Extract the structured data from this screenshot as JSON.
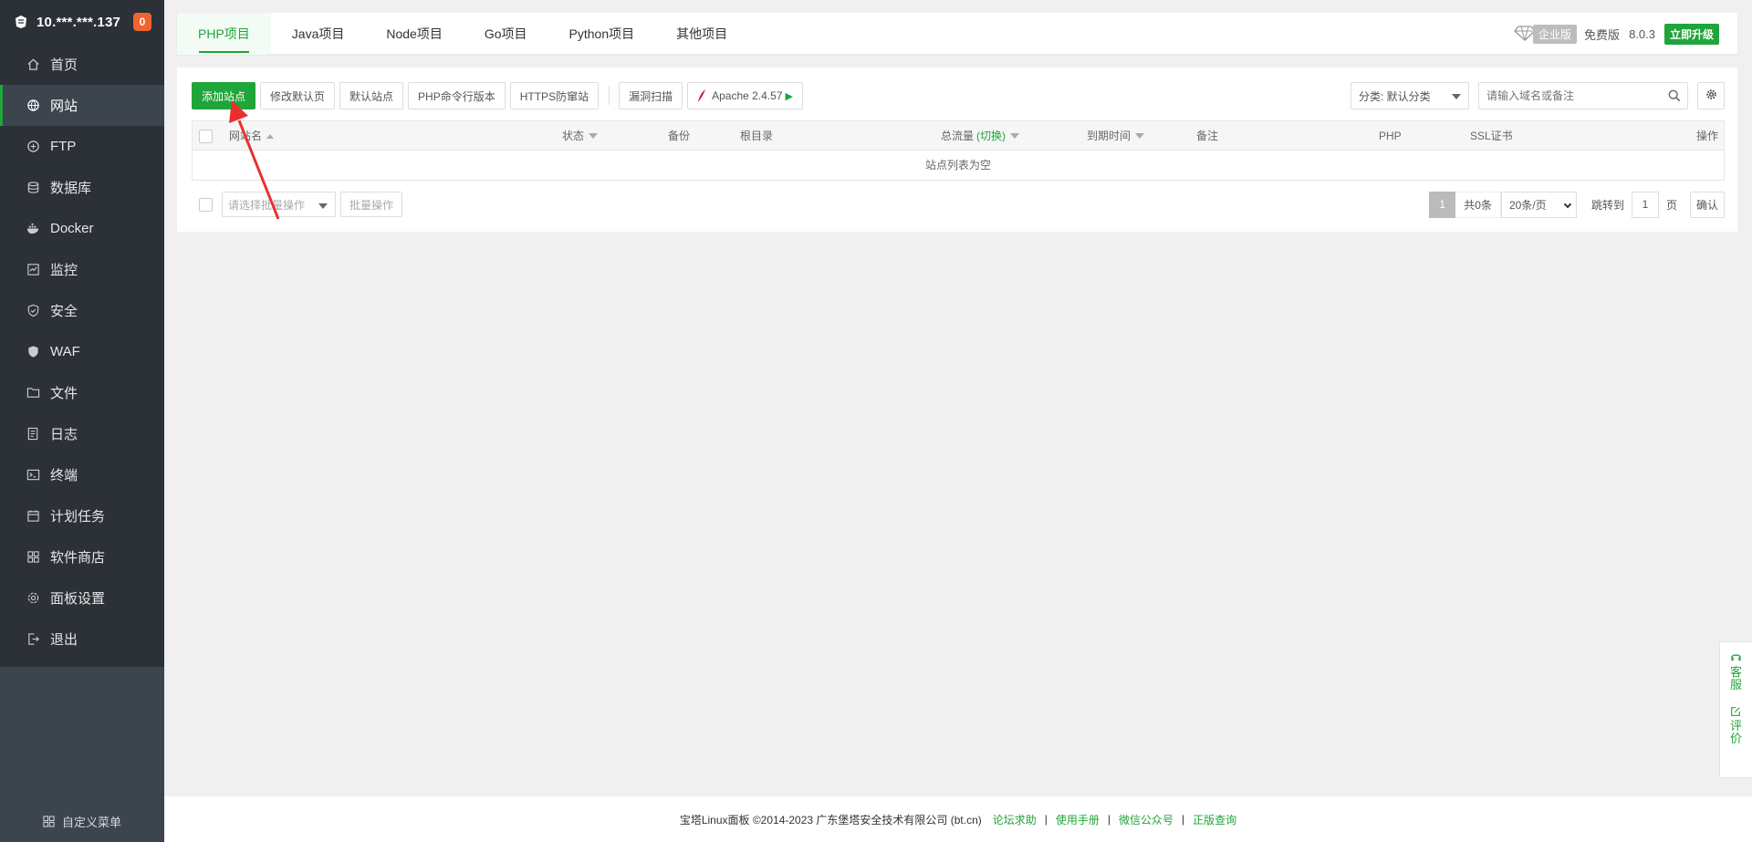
{
  "sidebar": {
    "server_ip": "10.***.***.137",
    "badge_count": "0",
    "items": [
      {
        "label": "首页",
        "icon": "home-icon"
      },
      {
        "label": "网站",
        "icon": "globe-icon",
        "active": true
      },
      {
        "label": "FTP",
        "icon": "ftp-icon"
      },
      {
        "label": "数据库",
        "icon": "database-icon"
      },
      {
        "label": "Docker",
        "icon": "docker-icon"
      },
      {
        "label": "监控",
        "icon": "monitor-icon"
      },
      {
        "label": "安全",
        "icon": "shield-icon"
      },
      {
        "label": "WAF",
        "icon": "waf-shield-icon"
      },
      {
        "label": "文件",
        "icon": "folder-icon"
      },
      {
        "label": "日志",
        "icon": "log-icon"
      },
      {
        "label": "终端",
        "icon": "terminal-icon"
      },
      {
        "label": "计划任务",
        "icon": "calendar-icon"
      },
      {
        "label": "软件商店",
        "icon": "apps-icon"
      },
      {
        "label": "面板设置",
        "icon": "gear-icon"
      },
      {
        "label": "退出",
        "icon": "logout-icon"
      }
    ],
    "custom_menu": "自定义菜单"
  },
  "header": {
    "tabs": [
      "PHP项目",
      "Java项目",
      "Node项目",
      "Go项目",
      "Python项目",
      "其他项目"
    ],
    "active_tab": 0,
    "enterprise_label": "企业版",
    "free_label": "免费版",
    "version": "8.0.3",
    "upgrade_label": "立即升级"
  },
  "toolbar": {
    "add_site": "添加站点",
    "edit_default_page": "修改默认页",
    "default_site": "默认站点",
    "php_cli_version": "PHP命令行版本",
    "https_protection": "HTTPS防窜站",
    "vuln_scan": "漏洞扫描",
    "apache": "Apache 2.4.57",
    "category_select": "分类: 默认分类",
    "search_placeholder": "请输入域名或备注"
  },
  "table": {
    "headers": {
      "site_name": "网站名",
      "status": "状态",
      "backup": "备份",
      "root_dir": "根目录",
      "traffic": "总流量",
      "traffic_switch": "(切换)",
      "expire": "到期时间",
      "remark": "备注",
      "php": "PHP",
      "ssl": "SSL证书",
      "actions": "操作"
    },
    "empty_text": "站点列表为空"
  },
  "batch": {
    "select_placeholder": "请选择批量操作",
    "batch_button": "批量操作"
  },
  "pagination": {
    "current": "1",
    "total": "共0条",
    "page_size": "20条/页",
    "jump_label": "跳转到",
    "jump_value": "1",
    "page_unit": "页",
    "confirm": "确认"
  },
  "footer": {
    "copyright": "宝塔Linux面板 ©2014-2023 广东堡塔安全技术有限公司 (bt.cn)",
    "links": [
      "论坛求助",
      "使用手册",
      "微信公众号",
      "正版查询"
    ]
  },
  "float_side": {
    "service": [
      "客",
      "服"
    ],
    "review": [
      "评",
      "价"
    ]
  },
  "colors": {
    "accent": "#20a53a",
    "sidebar_bg": "#3c444d",
    "sidebar_dark": "#2c3138",
    "badge": "#f0642d",
    "annotation_arrow": "#e8302f"
  }
}
